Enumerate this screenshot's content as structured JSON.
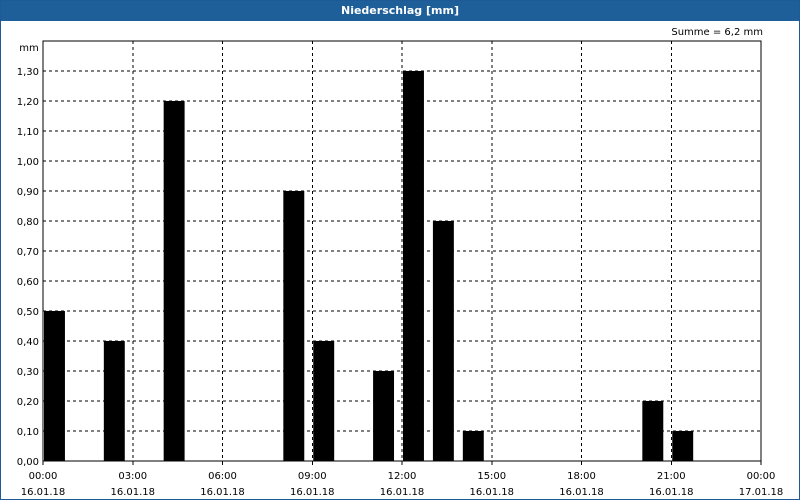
{
  "window": {
    "title": "Niederschlag [mm]"
  },
  "summary": {
    "text": "Summe = 6,2 mm"
  },
  "chart_data": {
    "type": "bar",
    "title": "Niederschlag [mm]",
    "ylabel": "mm",
    "ylim": [
      0,
      1.4
    ],
    "xlim_hours": [
      0,
      24
    ],
    "y_ticks": [
      "0,00",
      "0,10",
      "0,20",
      "0,30",
      "0,40",
      "0,50",
      "0,60",
      "0,70",
      "0,80",
      "0,90",
      "1,00",
      "1,10",
      "1,20",
      "1,30"
    ],
    "x_ticks": [
      {
        "time": "00:00",
        "date": "16.01.18"
      },
      {
        "time": "03:00",
        "date": "16.01.18"
      },
      {
        "time": "06:00",
        "date": "16.01.18"
      },
      {
        "time": "09:00",
        "date": "16.01.18"
      },
      {
        "time": "12:00",
        "date": "16.01.18"
      },
      {
        "time": "15:00",
        "date": "16.01.18"
      },
      {
        "time": "18:00",
        "date": "16.01.18"
      },
      {
        "time": "21:00",
        "date": "16.01.18"
      },
      {
        "time": "00:00",
        "date": "17.01.18"
      }
    ],
    "bar_color": "#000000",
    "grid": true,
    "series": [
      {
        "values": [
          {
            "time": "00:00",
            "value": 0.5
          },
          {
            "time": "02:00",
            "value": 0.4
          },
          {
            "time": "04:00",
            "value": 1.2
          },
          {
            "time": "08:00",
            "value": 0.9
          },
          {
            "time": "09:00",
            "value": 0.4
          },
          {
            "time": "11:00",
            "value": 0.3
          },
          {
            "time": "12:00",
            "value": 1.3
          },
          {
            "time": "13:00",
            "value": 0.8
          },
          {
            "time": "14:00",
            "value": 0.1
          },
          {
            "time": "20:00",
            "value": 0.2
          },
          {
            "time": "21:00",
            "value": 0.1
          }
        ]
      }
    ]
  }
}
